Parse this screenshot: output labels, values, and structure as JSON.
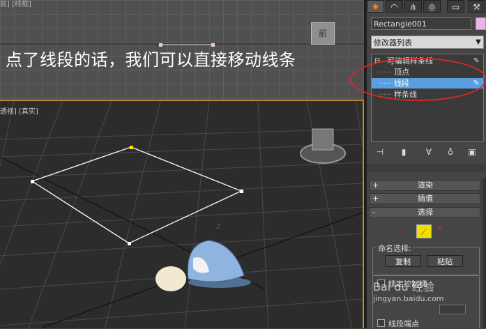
{
  "top_viewport": {
    "label": "[前] [线框]",
    "caption": "点了线段的话，我们可以直接移动线条",
    "viewcube_label": "前"
  },
  "bottom_viewport": {
    "label": "[透视] [真实]"
  },
  "panel": {
    "tabs": [
      "create-icon",
      "modify-icon",
      "hierarchy-icon",
      "motion-icon",
      "display-icon",
      "utilities-icon"
    ],
    "object_name": "Rectangle001",
    "object_color": "#e6b7e6",
    "modifier_list": "修改器列表",
    "stack": {
      "root": "可编辑样条线",
      "items": [
        "顶点",
        "线段",
        "样条线"
      ],
      "selected_index": 1
    },
    "rollouts": {
      "render": "渲染",
      "interpolation": "插值",
      "selection": "选择"
    },
    "named_selection": {
      "title": "命名选择:",
      "copy": "复制",
      "paste": "粘贴"
    },
    "lock_label": "锁定控制柄",
    "endpoint_label": "线段端点",
    "watermark": "Bai du 经验\njingyan.baidu.com",
    "accent_color": "#5aa0e0",
    "highlight_color": "#d62828"
  }
}
